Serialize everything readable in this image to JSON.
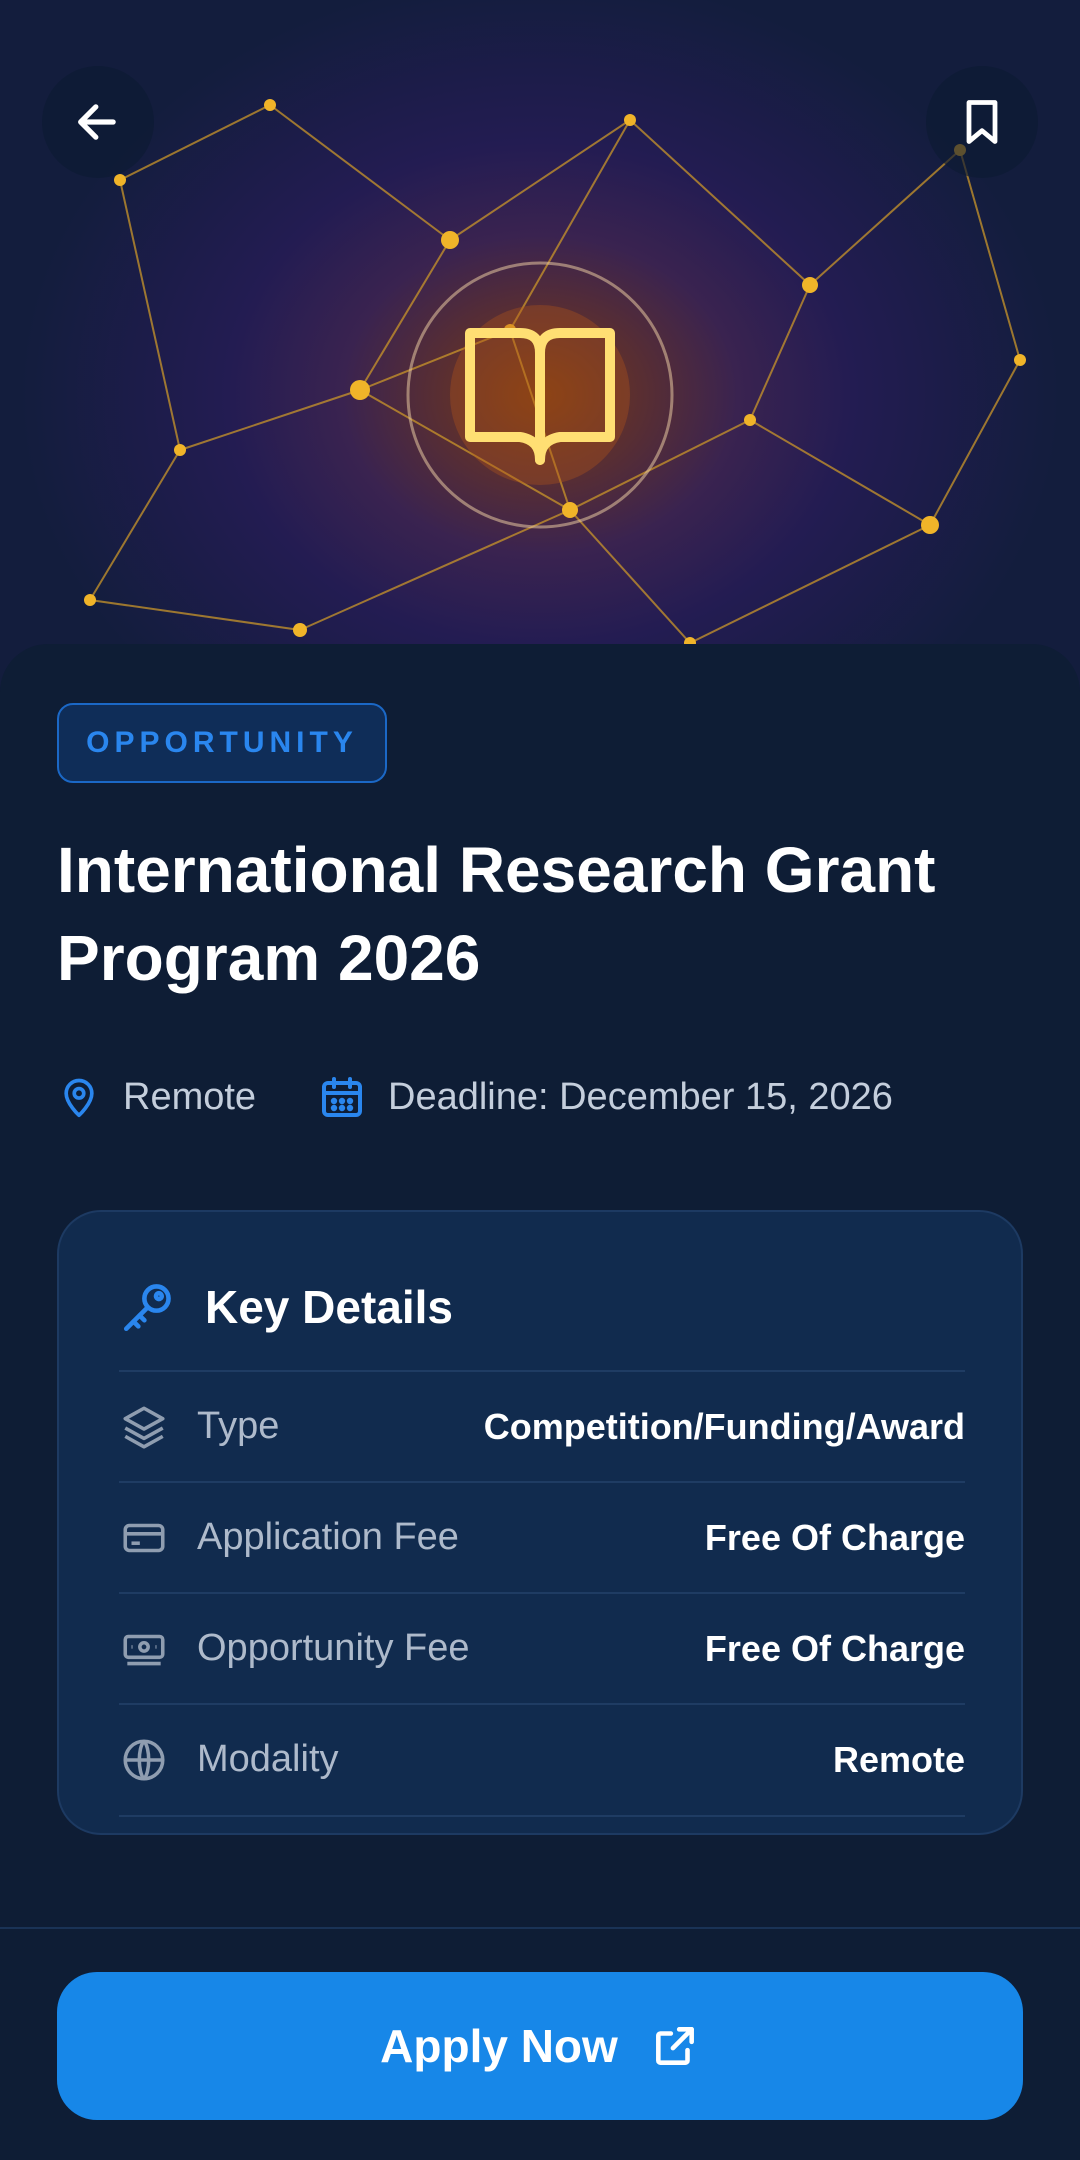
{
  "header": {
    "back_icon": "arrow-left-icon",
    "bookmark_icon": "bookmark-icon",
    "hero_icon": "open-book-icon"
  },
  "category_badge": "OPPORTUNITY",
  "title": "International Research Grant Program 2026",
  "meta": {
    "location": "Remote",
    "deadline": "Deadline: December 15, 2026"
  },
  "key_details": {
    "heading": "Key Details",
    "rows": [
      {
        "icon": "layers-icon",
        "label": "Type",
        "value": "Competition/Funding/Award"
      },
      {
        "icon": "credit-card-icon",
        "label": "Application Fee",
        "value": "Free Of Charge"
      },
      {
        "icon": "banknote-icon",
        "label": "Opportunity Fee",
        "value": "Free Of Charge"
      },
      {
        "icon": "globe-icon",
        "label": "Modality",
        "value": "Remote"
      }
    ]
  },
  "cta": {
    "label": "Apply Now",
    "icon": "external-link-icon"
  },
  "colors": {
    "accent": "#1787e8",
    "background": "#0e1d35",
    "card": "#112b4e",
    "network_gold": "#f0b429",
    "book_yellow": "#ffdf73"
  }
}
